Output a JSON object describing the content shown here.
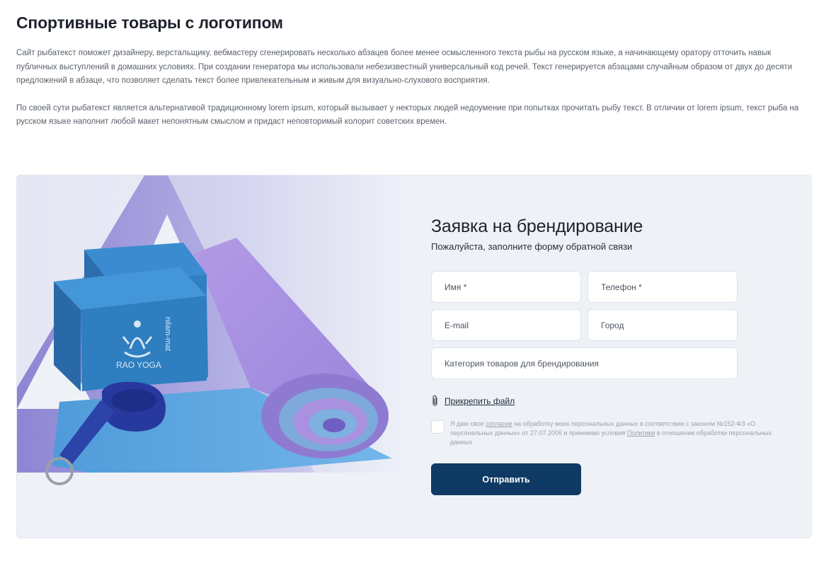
{
  "header": {
    "title": "Спортивные товары с логотипом"
  },
  "intro": {
    "paragraph1": "Сайт рыбатекст поможет дизайнеру, верстальщику, вебмастеру сгенерировать несколько абзацев более менее осмысленного текста рыбы на русском языке, а начинающему оратору отточить навык публичных выступлений в домашних условиях. При создании генератора мы использовали небезизвестный универсальный код речей. Текст генерируется абзацами случайным образом от двух до десяти предложений в абзаце, что позволяет сделать текст более привлекательным и живым для визуально-слухового восприятия.",
    "paragraph2": "По своей сути рыбатекст является альтернативой традиционному lorem ipsum, который вызывает у некторых людей недоумение при попытках прочитать рыбу текст. В отличии от lorem ipsum, текст рыба на русском языке наполнит любой макет непонятным смыслом и придаст неповторимый колорит советских времен."
  },
  "product_image": {
    "brand_text": "RAO YOGA",
    "side_text": "nilam-mat"
  },
  "form": {
    "title": "Заявка на брендирование",
    "subtitle": "Пожалуйста, заполните форму обратной связи",
    "fields": {
      "name_placeholder": "Имя *",
      "phone_placeholder": "Телефон *",
      "email_placeholder": "E-mail",
      "city_placeholder": "Город",
      "category_placeholder": "Категория товаров для брендирования"
    },
    "attach_label": "Прикрепить файл",
    "attach_icon": "paperclip-icon",
    "consent": {
      "checked": false,
      "before": "Я даю свое ",
      "link1": "согласие",
      "middle": " на обработку моих персональных данных в соответствии с законом №152-ФЗ «О персональных данных» от 27.07.2006 и принимаю условия ",
      "link2": "Политики",
      "after": " в отношении обработки персональных данных"
    },
    "submit_label": "Отправить"
  },
  "colors": {
    "accent": "#0f3a63",
    "card_background": "#eef2f7",
    "mat_top": "#a98be0",
    "mat_bottom": "#63a9e3",
    "blocks": "#2e7ec0",
    "strap": "#27399e",
    "backdrop": "#8e86d4"
  }
}
